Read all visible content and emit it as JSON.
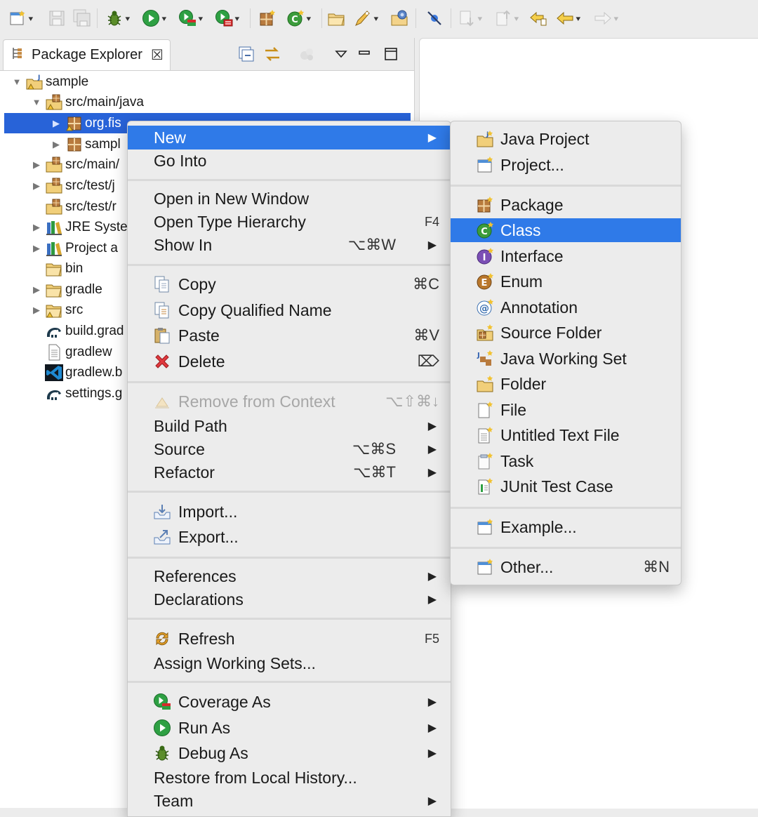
{
  "toolbar": {
    "icons": [
      "new-wizard-icon",
      "save-icon",
      "save-all-icon",
      "debug-icon",
      "run-icon",
      "coverage-icon",
      "external-tools-icon",
      "new-java-package-icon",
      "new-java-class-icon",
      "open-type-icon",
      "search-icon",
      "open-task-icon",
      "skip-breakpoints-icon",
      "next-annotation-icon",
      "previous-annotation-icon",
      "last-edit-location-icon",
      "back-icon",
      "forward-icon"
    ]
  },
  "explorer": {
    "tab_title": "Package Explorer",
    "close_glyph": "☒",
    "tree": [
      {
        "label": "sample",
        "twisty": "▼"
      },
      {
        "label": "src/main/java",
        "twisty": "▼"
      },
      {
        "label": "org.fis",
        "twisty": "▶"
      },
      {
        "label": "sampl",
        "twisty": "▶"
      },
      {
        "label": "src/main/",
        "twisty": "▶"
      },
      {
        "label": "src/test/j",
        "twisty": "▶"
      },
      {
        "label": "src/test/r",
        "twisty": ""
      },
      {
        "label": "JRE Syste",
        "twisty": "▶"
      },
      {
        "label": "Project a",
        "twisty": "▶"
      },
      {
        "label": "bin",
        "twisty": ""
      },
      {
        "label": "gradle",
        "twisty": "▶"
      },
      {
        "label": "src",
        "twisty": "▶"
      },
      {
        "label": "build.grad",
        "twisty": ""
      },
      {
        "label": "gradlew",
        "twisty": ""
      },
      {
        "label": "gradlew.b",
        "twisty": ""
      },
      {
        "label": "settings.g",
        "twisty": ""
      }
    ]
  },
  "context_menu": {
    "items": [
      {
        "label": "New",
        "shortcut": "",
        "arrow": "▶"
      },
      {
        "label": "Go Into",
        "shortcut": "",
        "arrow": ""
      },
      {
        "label": "Open in New Window",
        "shortcut": "",
        "arrow": ""
      },
      {
        "label": "Open Type Hierarchy",
        "shortcut": "F4",
        "arrow": ""
      },
      {
        "label": "Show In",
        "shortcut": "⌥⌘W",
        "arrow": "▶"
      },
      {
        "label": "Copy",
        "shortcut": "⌘C",
        "arrow": ""
      },
      {
        "label": "Copy Qualified Name",
        "shortcut": "",
        "arrow": ""
      },
      {
        "label": "Paste",
        "shortcut": "⌘V",
        "arrow": ""
      },
      {
        "label": "Delete",
        "shortcut": "⌦",
        "arrow": ""
      },
      {
        "label": "Remove from Context",
        "shortcut": "⌥⇧⌘↓",
        "arrow": ""
      },
      {
        "label": "Build Path",
        "shortcut": "",
        "arrow": "▶"
      },
      {
        "label": "Source",
        "shortcut": "⌥⌘S",
        "arrow": "▶"
      },
      {
        "label": "Refactor",
        "shortcut": "⌥⌘T",
        "arrow": "▶"
      },
      {
        "label": "Import...",
        "shortcut": "",
        "arrow": ""
      },
      {
        "label": "Export...",
        "shortcut": "",
        "arrow": ""
      },
      {
        "label": "References",
        "shortcut": "",
        "arrow": "▶"
      },
      {
        "label": "Declarations",
        "shortcut": "",
        "arrow": "▶"
      },
      {
        "label": "Refresh",
        "shortcut": "F5",
        "arrow": ""
      },
      {
        "label": "Assign Working Sets...",
        "shortcut": "",
        "arrow": ""
      },
      {
        "label": "Coverage As",
        "shortcut": "",
        "arrow": "▶"
      },
      {
        "label": "Run As",
        "shortcut": "",
        "arrow": "▶"
      },
      {
        "label": "Debug As",
        "shortcut": "",
        "arrow": "▶"
      },
      {
        "label": "Restore from Local History...",
        "shortcut": "",
        "arrow": ""
      },
      {
        "label": "Team",
        "shortcut": "",
        "arrow": "▶"
      }
    ]
  },
  "new_submenu": {
    "items": [
      {
        "label": "Java Project",
        "shortcut": ""
      },
      {
        "label": "Project...",
        "shortcut": ""
      },
      {
        "label": "Package",
        "shortcut": ""
      },
      {
        "label": "Class",
        "shortcut": ""
      },
      {
        "label": "Interface",
        "shortcut": ""
      },
      {
        "label": "Enum",
        "shortcut": ""
      },
      {
        "label": "Annotation",
        "shortcut": ""
      },
      {
        "label": "Source Folder",
        "shortcut": ""
      },
      {
        "label": "Java Working Set",
        "shortcut": ""
      },
      {
        "label": "Folder",
        "shortcut": ""
      },
      {
        "label": "File",
        "shortcut": ""
      },
      {
        "label": "Untitled Text File",
        "shortcut": ""
      },
      {
        "label": "Task",
        "shortcut": ""
      },
      {
        "label": "JUnit Test Case",
        "shortcut": ""
      },
      {
        "label": "Example...",
        "shortcut": ""
      },
      {
        "label": "Other...",
        "shortcut": "⌘N"
      }
    ]
  },
  "colors": {
    "selection": "#2863d8",
    "menu_highlight": "#2f7ae8",
    "menu_bg": "#ececec",
    "disabled_text": "#a7a7a7"
  }
}
